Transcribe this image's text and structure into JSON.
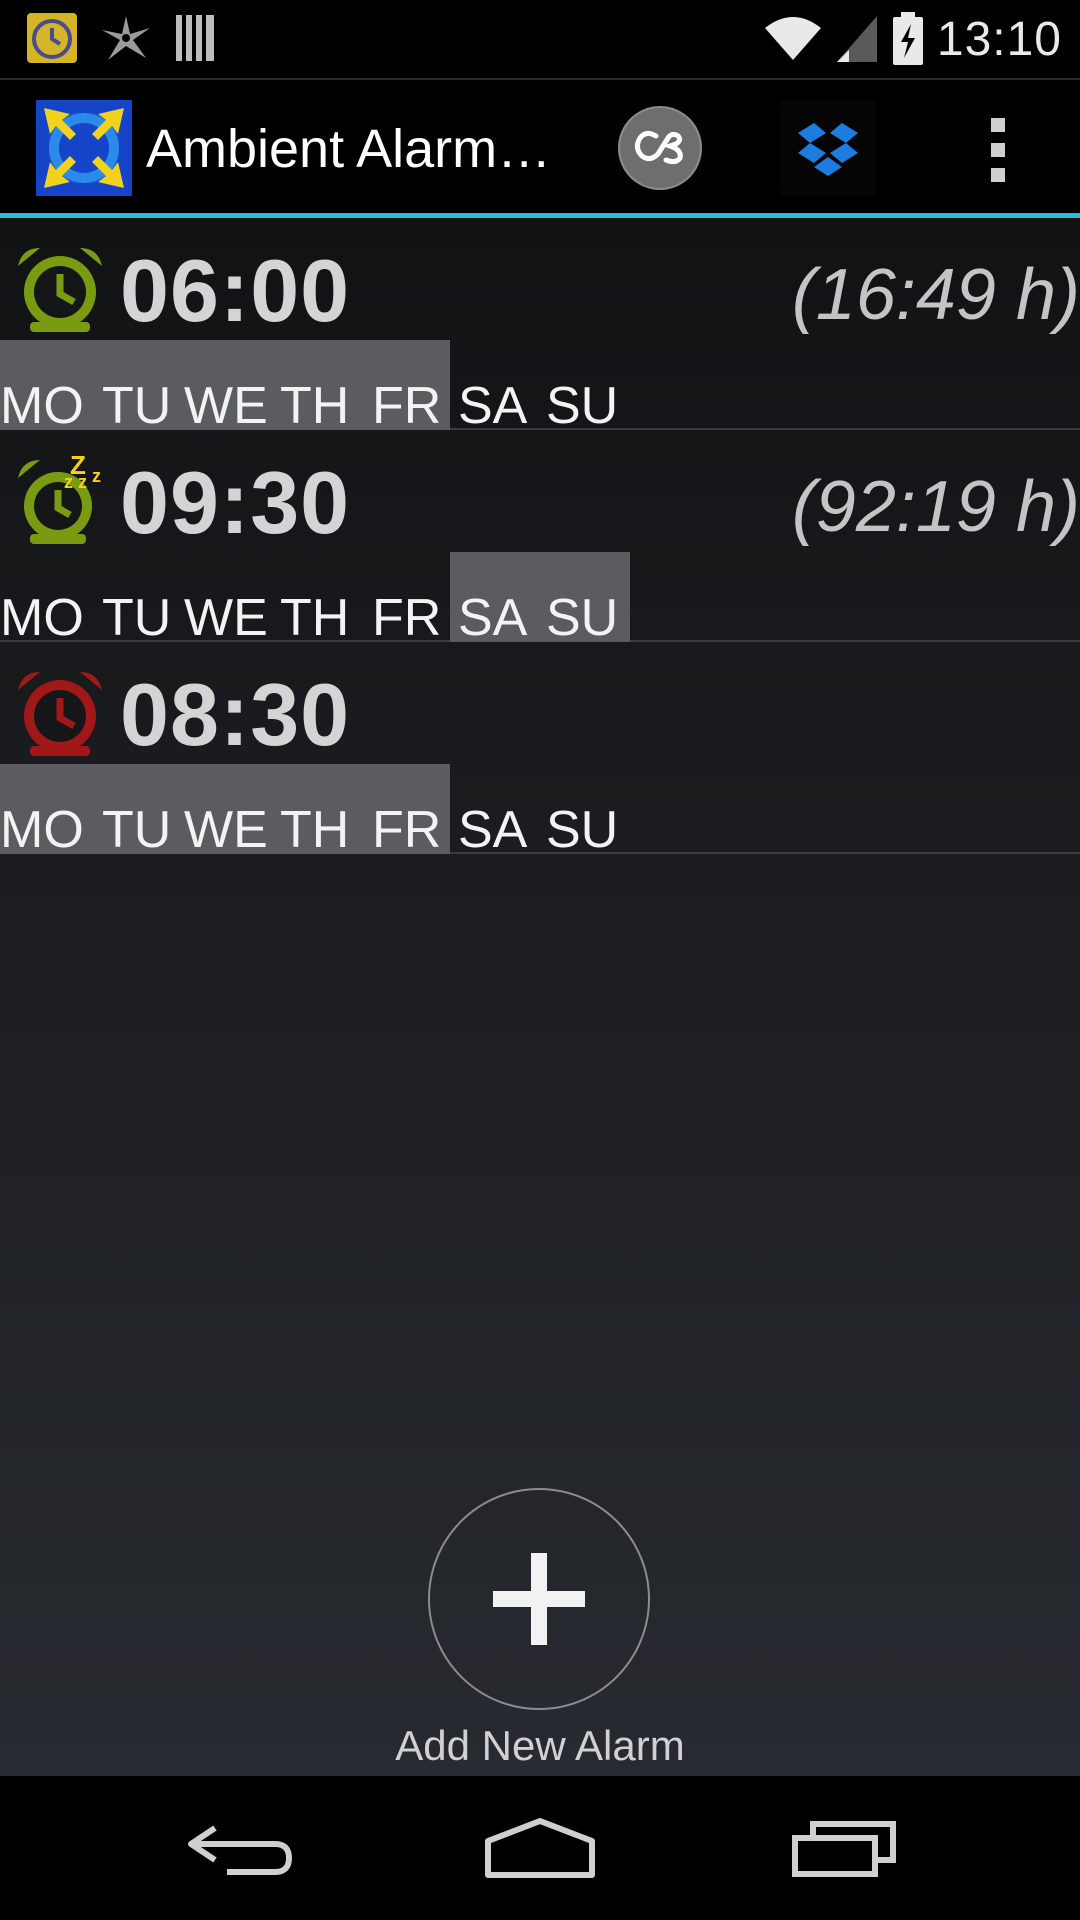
{
  "status_bar": {
    "time": "13:10",
    "left_icons": [
      "alarm-clock-notification-icon",
      "ninja-star-notification-icon",
      "barcode-notification-icon"
    ],
    "right_icons": [
      "wifi-icon",
      "signal-icon",
      "battery-charging-icon"
    ]
  },
  "action_bar": {
    "title": "Ambient Alarm…",
    "actions": [
      "lastfm-icon",
      "dropbox-icon",
      "overflow-menu-icon"
    ],
    "accent_color": "#33b5e5"
  },
  "alarms": [
    {
      "time": "06:00",
      "remaining": "(16:49 h)",
      "status": "active",
      "icon": "alarm-clock-green-icon",
      "days": [
        "MO",
        "TU",
        "WE",
        "TH",
        "FR",
        "SA",
        "SU"
      ],
      "selected_days": [
        "MO",
        "TU",
        "WE",
        "TH",
        "FR"
      ]
    },
    {
      "time": "09:30",
      "remaining": "(92:19 h)",
      "status": "snoozing",
      "icon": "alarm-clock-green-zzz-icon",
      "days": [
        "MO",
        "TU",
        "WE",
        "TH",
        "FR",
        "SA",
        "SU"
      ],
      "selected_days": [
        "SA",
        "SU"
      ]
    },
    {
      "time": "08:30",
      "remaining": "",
      "status": "disabled",
      "icon": "alarm-clock-red-icon",
      "days": [
        "MO",
        "TU",
        "WE",
        "TH",
        "FR",
        "SA",
        "SU"
      ],
      "selected_days": [
        "MO",
        "TU",
        "WE",
        "TH",
        "FR"
      ]
    }
  ],
  "add_alarm": {
    "label": "Add New Alarm",
    "icon": "plus-icon"
  },
  "nav_bar": {
    "buttons": [
      "back-icon",
      "home-icon",
      "recent-apps-icon"
    ]
  },
  "colors": {
    "active_icon": "#7a9a12",
    "disabled_icon": "#a01818",
    "day_highlight": "#5b5c5f"
  }
}
